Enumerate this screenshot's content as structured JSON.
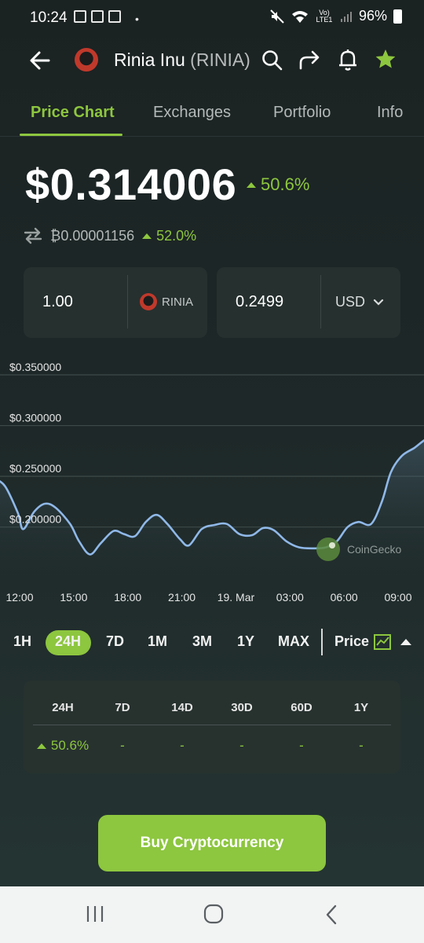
{
  "status_bar": {
    "time": "10:24",
    "dot": "•",
    "network": "Vo) LTE1",
    "battery": "96%"
  },
  "header": {
    "coin_name": "Rinia Inu",
    "coin_symbol": "(RINIA)",
    "icons": [
      "back-arrow-icon",
      "coin-logo",
      "search-icon",
      "share-icon",
      "bell-icon",
      "star-icon"
    ]
  },
  "tabs": [
    {
      "label": "Price Chart",
      "active": true
    },
    {
      "label": "Exchanges",
      "active": false
    },
    {
      "label": "Portfolio",
      "active": false
    },
    {
      "label": "Info",
      "active": false
    }
  ],
  "price": {
    "usd": "$0.314006",
    "change_24h": "50.6%",
    "btc": "₿0.00001156",
    "btc_change": "52.0%"
  },
  "converter": {
    "amount": "1.00",
    "token": "RINIA",
    "value": "0.2499",
    "currency": "USD"
  },
  "chart_data": {
    "type": "line",
    "x": [
      "12:00",
      "15:00",
      "18:00",
      "21:00",
      "19. Mar",
      "03:00",
      "06:00",
      "09:00"
    ],
    "y_ticks": [
      "$0.350000",
      "$0.300000",
      "$0.250000",
      "$0.200000"
    ],
    "ylim": [
      0.168,
      0.35
    ],
    "watermark": "CoinGecko",
    "series": [
      {
        "values": [
          [
            10.6,
            0.248
          ],
          [
            11.2,
            0.24
          ],
          [
            11.9,
            0.214
          ],
          [
            12.2,
            0.198
          ],
          [
            12.8,
            0.215
          ],
          [
            13.4,
            0.223
          ],
          [
            14.0,
            0.219
          ],
          [
            14.8,
            0.203
          ],
          [
            15.3,
            0.186
          ],
          [
            15.9,
            0.173
          ],
          [
            16.5,
            0.184
          ],
          [
            17.2,
            0.196
          ],
          [
            17.8,
            0.193
          ],
          [
            18.4,
            0.191
          ],
          [
            19.0,
            0.205
          ],
          [
            19.6,
            0.212
          ],
          [
            20.2,
            0.203
          ],
          [
            20.9,
            0.188
          ],
          [
            21.4,
            0.182
          ],
          [
            22.1,
            0.198
          ],
          [
            22.8,
            0.202
          ],
          [
            23.5,
            0.203
          ],
          [
            24.2,
            0.193
          ],
          [
            24.9,
            0.192
          ],
          [
            25.5,
            0.199
          ],
          [
            26.1,
            0.197
          ],
          [
            26.8,
            0.186
          ],
          [
            27.5,
            0.18
          ],
          [
            28.3,
            0.179
          ],
          [
            29.0,
            0.18
          ],
          [
            29.6,
            0.186
          ],
          [
            30.2,
            0.2
          ],
          [
            30.8,
            0.205
          ],
          [
            31.5,
            0.203
          ],
          [
            32.1,
            0.225
          ],
          [
            32.6,
            0.254
          ],
          [
            33.2,
            0.27
          ],
          [
            33.9,
            0.278
          ],
          [
            34.6,
            0.287
          ],
          [
            35.3,
            0.289
          ],
          [
            35.8,
            0.292
          ],
          [
            36.4,
            0.315
          ]
        ]
      }
    ],
    "x_hours_at_ticks": [
      12,
      15,
      18,
      21,
      24,
      27,
      30,
      33
    ]
  },
  "ranges": {
    "items": [
      "1H",
      "24H",
      "7D",
      "1M",
      "3M",
      "1Y",
      "MAX"
    ],
    "active": "24H",
    "toggle_label": "Price"
  },
  "performance": {
    "headers": [
      "24H",
      "7D",
      "14D",
      "30D",
      "60D",
      "1Y"
    ],
    "values": [
      "50.6%",
      "-",
      "-",
      "-",
      "-",
      "-"
    ]
  },
  "buy_button": "Buy Cryptocurrency",
  "colors": {
    "accent": "#8dc63f",
    "background": "#1e2828",
    "line": "#8fb8e8"
  }
}
